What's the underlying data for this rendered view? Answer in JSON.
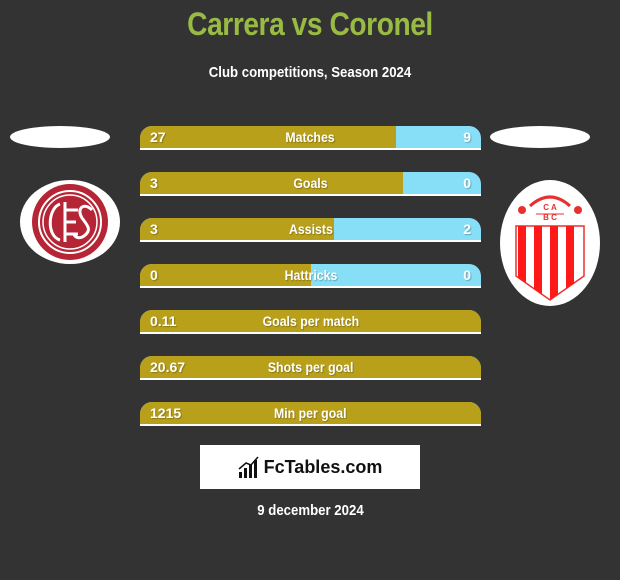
{
  "header": {
    "title": "Carrera vs Coronel",
    "subtitle": "Club competitions, Season 2024"
  },
  "teams": {
    "left": {
      "name": "Carrera",
      "crest_icon": "lanus-crest-icon",
      "color": "#b8a01a"
    },
    "right": {
      "name": "Coronel",
      "crest_icon": "barracas-central-crest-icon",
      "color": "#87dff7"
    }
  },
  "colors": {
    "background": "#333333",
    "title": "#99bb44",
    "left_bar": "#b8a01a",
    "right_bar": "#87dff7"
  },
  "stats": [
    {
      "label": "Matches",
      "left": "27",
      "right": "9",
      "left_share": 0.75
    },
    {
      "label": "Goals",
      "left": "3",
      "right": "0",
      "left_share": 0.77
    },
    {
      "label": "Assists",
      "left": "3",
      "right": "2",
      "left_share": 0.57
    },
    {
      "label": "Hattricks",
      "left": "0",
      "right": "0",
      "left_share": 0.5
    },
    {
      "label": "Goals per match",
      "left": "0.11",
      "right": "",
      "left_share": 1.0
    },
    {
      "label": "Shots per goal",
      "left": "20.67",
      "right": "",
      "left_share": 1.0
    },
    {
      "label": "Min per goal",
      "left": "1215",
      "right": "",
      "left_share": 1.0
    }
  ],
  "brand": {
    "name": "FcTables.com",
    "icon": "bar-chart-icon"
  },
  "footer": {
    "date": "9 december 2024"
  }
}
